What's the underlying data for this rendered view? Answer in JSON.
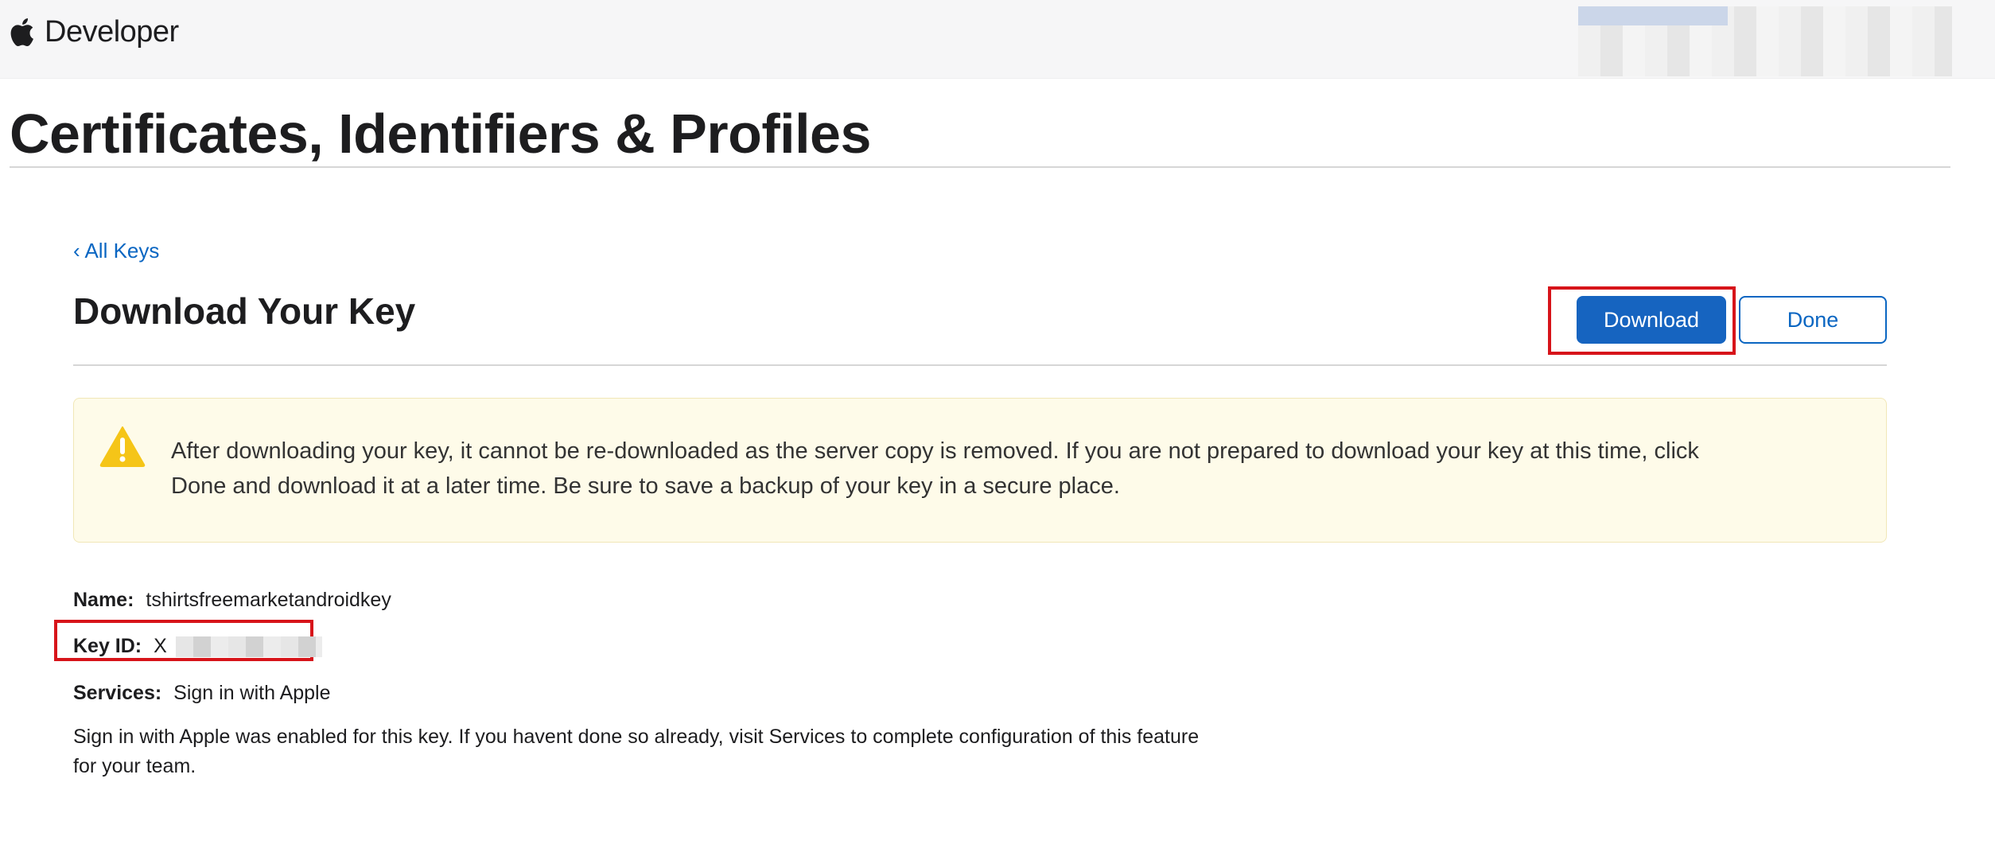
{
  "header": {
    "brand_label": "Developer",
    "logo_icon": "apple-logo-icon",
    "account_redacted": true
  },
  "page": {
    "title": "Certificates, Identifiers & Profiles"
  },
  "content": {
    "back_link": "‹ All Keys",
    "section_title": "Download Your Key",
    "download_button": "Download",
    "done_button": "Done",
    "warning": {
      "icon": "warning-triangle-icon",
      "text": "After downloading your key, it cannot be re-downloaded as the server copy is removed. If you are not prepared to download your key at this time, click Done and download it at a later time. Be sure to save a backup of your key in a secure place."
    },
    "details": {
      "name_label": "Name:",
      "name_value": "tshirtsfreemarketandroidkey",
      "key_id_label": "Key ID:",
      "key_id_value_prefix": "X",
      "services_label": "Services:",
      "services_value": "Sign in with Apple"
    },
    "note": "Sign in with Apple was enabled for this key. If you havent done so already, visit Services to complete configuration of this feature for your team."
  },
  "colors": {
    "accent": "#1664c0",
    "link": "#0a66c2",
    "highlight": "#d7141a",
    "warning_bg": "#fefbe9",
    "warning_icon": "#f5c518"
  }
}
